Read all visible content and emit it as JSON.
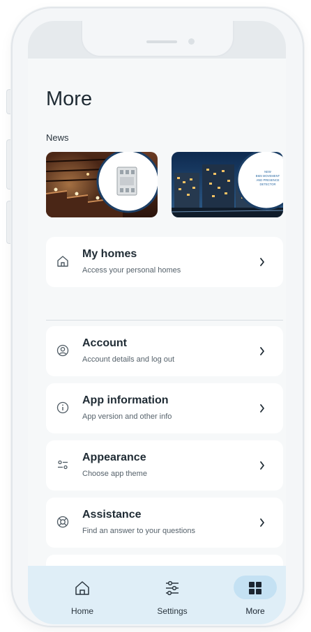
{
  "page": {
    "title": "More",
    "news_label": "News"
  },
  "news": [
    {
      "image": "stairs-lighting-relay-photo"
    },
    {
      "image": "office-building-night-photo",
      "caption": "NEW\nBMS MOVEMENT\nAND PRESENCE\nDETECTOR"
    },
    {
      "image": "partial-news-photo"
    }
  ],
  "sections": {
    "homes": {
      "title": "My homes",
      "subtitle": "Access your personal homes",
      "icon": "home-outline-icon"
    },
    "items": [
      {
        "title": "Account",
        "subtitle": "Account details and log out",
        "icon": "user-circle-icon"
      },
      {
        "title": "App information",
        "subtitle": "App version and other info",
        "icon": "info-circle-icon"
      },
      {
        "title": "Appearance",
        "subtitle": "Choose app theme",
        "icon": "toggle-sliders-icon"
      },
      {
        "title": "Assistance",
        "subtitle": "Find an answer to your questions",
        "icon": "lifebuoy-icon"
      }
    ]
  },
  "nav": {
    "home": "Home",
    "settings": "Settings",
    "more": "More",
    "active": "More"
  },
  "colors": {
    "background": "#f6f8f9",
    "card": "#ffffff",
    "nav_bar": "#dfeef7",
    "nav_active_pill": "#c4e1f3",
    "text_primary": "#1f2b34"
  }
}
